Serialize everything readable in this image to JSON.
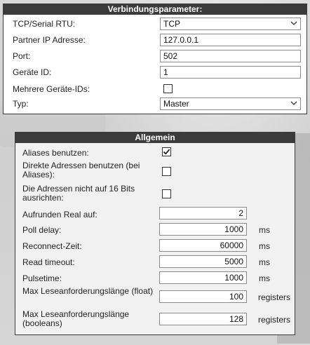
{
  "verbindung": {
    "title": "Verbindungsparameter:",
    "tcp_serial_label": "TCP/Serial RTU:",
    "tcp_serial_value": "TCP",
    "ip_label": "Partner IP Adresse:",
    "ip_value": "127.0.0.1",
    "port_label": "Port:",
    "port_value": "502",
    "device_id_label": "Geräte ID:",
    "device_id_value": "1",
    "multi_ids_label": "Mehrere Geräte-IDs:",
    "multi_ids_checked": false,
    "typ_label": "Typ:",
    "typ_value": "Master"
  },
  "allgemein": {
    "title": "Allgemein",
    "aliases_label": "Aliases benutzen:",
    "aliases_checked": true,
    "direct_label": "Direkte Adressen benutzen (bei Aliases):",
    "direct_checked": false,
    "align_label": "Die Adressen nicht auf 16 Bits ausrichten:",
    "align_checked": false,
    "round_label": "Aufrunden Real auf:",
    "round_value": "2",
    "poll_label": "Poll delay:",
    "poll_value": "1000",
    "poll_unit": "ms",
    "reconnect_label": "Reconnect-Zeit:",
    "reconnect_value": "60000",
    "reconnect_unit": "ms",
    "readtimeout_label": "Read timeout:",
    "readtimeout_value": "5000",
    "readtimeout_unit": "ms",
    "pulse_label": "Pulsetime:",
    "pulse_value": "1000",
    "pulse_unit": "ms",
    "maxfloat_label": "Max Leseanforderungslänge (float)",
    "maxfloat_value": "100",
    "maxfloat_unit": "registers",
    "maxbool_label": "Max Leseanforderungslänge (booleans)",
    "maxbool_value": "128",
    "maxbool_unit": "registers"
  },
  "icons": {
    "dropdown": "chevron-down-icon",
    "check": "checkmark-icon"
  }
}
